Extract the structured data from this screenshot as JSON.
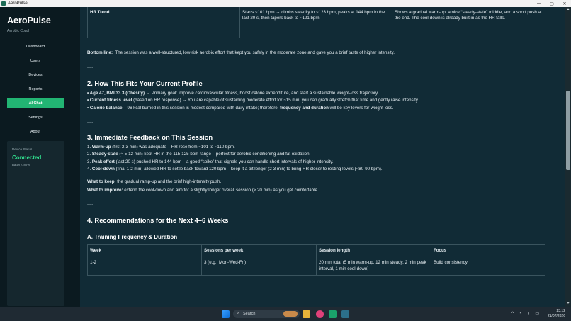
{
  "window": {
    "title": "AeroPulse",
    "minimize": "—",
    "maximize": "▢",
    "close": "✕"
  },
  "sidebar": {
    "app_name": "AeroPulse",
    "app_subtitle": "Aerobic Coach",
    "items": [
      {
        "label": "Dashboard"
      },
      {
        "label": "Users"
      },
      {
        "label": "Devices"
      },
      {
        "label": "Reports"
      },
      {
        "label": "AI Chat",
        "active": true
      },
      {
        "label": "Settings"
      },
      {
        "label": "About"
      }
    ],
    "device": {
      "label": "Device Status",
      "status": "Connected",
      "battery": "Battery: 80%"
    }
  },
  "content": {
    "hr_trend_row": {
      "col1": "HR Trend",
      "col2": "Starts ~101 bpm → climbs steadily to ~123 bpm, peaks at 144 bpm in the last 20 s, then tapers back to ~121 bpm",
      "col3": "Shows a gradual warm-up, a nice “steady-state” middle, and a short push at the end. The cool-down is already built in as the HR falls."
    },
    "bottom_line_label": "Bottom line:",
    "bottom_line_text": "The session was a well-structured, low-risk aerobic effort that kept you safely in the moderate zone and gave you a brief taste of higher intensity.",
    "separator": "---",
    "section2_title": "2. How This Fits Your Current Profile",
    "profile": [
      {
        "lead": "• Age 47, BMI 33.3 (Obesity)",
        "text": " → Primary goal: improve cardiovascular fitness, boost calorie expenditure, and start a sustainable weight-loss trajectory."
      },
      {
        "lead": "• Current fitness level",
        "text": " (based on HR response) → You are capable of sustaining moderate effort for ~15 min; you can gradually stretch that time and gently raise intensity."
      },
      {
        "lead": "• Calorie balance",
        "text": " – 96 kcal burned in this session is modest compared with daily intake; therefore, ",
        "bold2": "frequency and duration",
        "text2": " will be key levers for weight loss."
      }
    ],
    "section3_title": "3. Immediate Feedback on This Session",
    "feedback": [
      {
        "num": "1. ",
        "lead": "Warm-up",
        "text": " (first 2-3 min) was adequate – HR rose from ~101 to ~110 bpm."
      },
      {
        "num": "2. ",
        "lead": "Steady-state",
        "text": " (≈ 5-12 min) kept HR in the 115-125 bpm range – perfect for aerobic conditioning and fat oxidation."
      },
      {
        "num": "3. ",
        "lead": "Peak effort",
        "text": " (last 20 s) pushed HR to 144 bpm – a good “spike” that signals you can handle short intervals of higher intensity."
      },
      {
        "num": "4. ",
        "lead": "Cool-down",
        "text": " (final 1-2 min) allowed HR to settle back toward 120 bpm – keep it a bit longer (2-3 min) to bring HR closer to resting levels (~80-90 bpm)."
      }
    ],
    "keep_label": "What to keep:",
    "keep_text": " the gradual ramp-up and the brief high-intensity push.",
    "improve_label": "What to improve:",
    "improve_text": " extend the cool-down and aim for a slightly longer overall session (≥ 20 min) as you get comfortable.",
    "section4_title": "4. Recommendations for the Next 4–6 Weeks",
    "subsectionA_title": "A. Training Frequency & Duration",
    "table_headers": [
      "Week",
      "Sessions per week",
      "Session length",
      "Focus"
    ],
    "table_rows": [
      {
        "week": "1-2",
        "sessions": "3 (e.g., Mon-Wed-Fri)",
        "length": "20 min total (5 min warm-up, 12 min steady, 2 min peak interval, 1 min cool-down)",
        "focus": "Build consistency"
      }
    ]
  },
  "taskbar": {
    "search_placeholder": "Search",
    "time": "23:12",
    "date": "21/07/2026"
  },
  "colors": {
    "accent": "#22b573",
    "connected": "#2fd68a",
    "content_bg": "#112b36",
    "sidebar_bg": "#0b1a20"
  }
}
